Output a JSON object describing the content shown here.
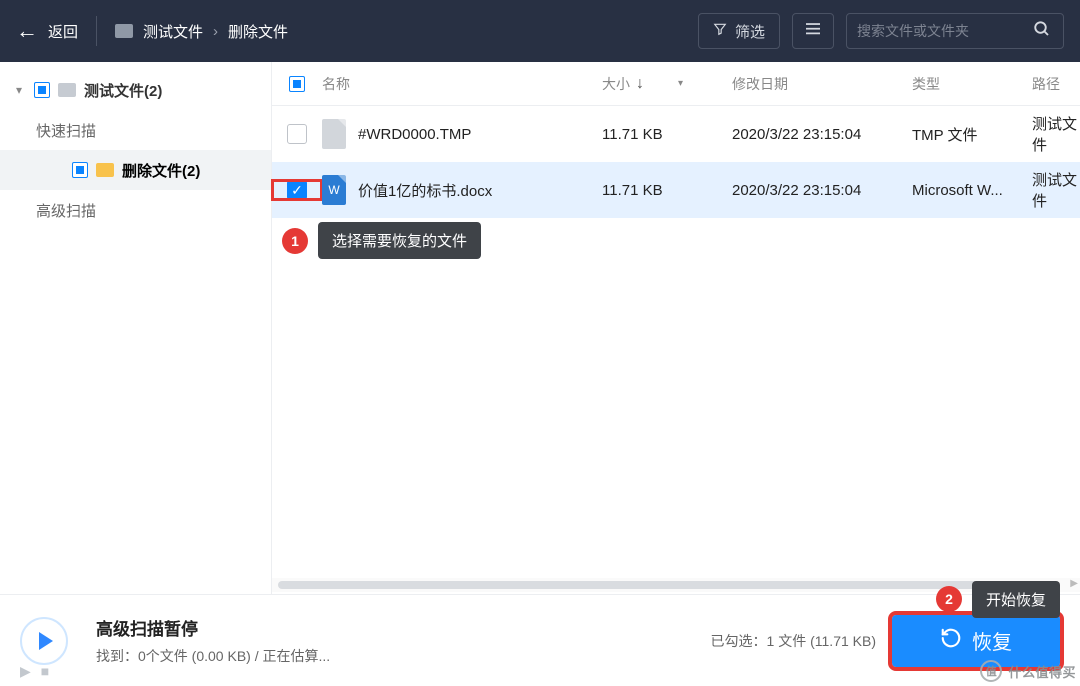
{
  "topbar": {
    "back_label": "返回",
    "breadcrumb": [
      "测试文件",
      "删除文件"
    ],
    "filter_label": "筛选",
    "search_placeholder": "搜索文件或文件夹"
  },
  "sidebar": {
    "root_label": "测试文件(2)",
    "quick_scan_label": "快速扫描",
    "deleted_label": "删除文件(2)",
    "deep_scan_label": "高级扫描"
  },
  "columns": {
    "name": "名称",
    "size": "大小",
    "date": "修改日期",
    "type": "类型",
    "path": "路径"
  },
  "files": [
    {
      "name": "#WRD0000.TMP",
      "size": "11.71 KB",
      "date": "2020/3/22 23:15:04",
      "type": "TMP 文件",
      "path": "测试文件",
      "icon": "generic",
      "checked": false
    },
    {
      "name": "价值1亿的标书.docx",
      "size": "11.71 KB",
      "date": "2020/3/22 23:15:04",
      "type": "Microsoft W...",
      "path": "测试文件",
      "icon": "word",
      "checked": true
    }
  ],
  "annotations": {
    "step1": "选择需要恢复的文件",
    "step2": "开始恢复"
  },
  "bottom": {
    "title": "高级扫描暂停",
    "subtitle": "找到：0个文件 (0.00 KB) / 正在估算...",
    "selected_label": "已勾选：",
    "selected_value": "1 文件 (11.71 KB)",
    "recover_label": "恢复"
  },
  "watermark": "什么值得买"
}
